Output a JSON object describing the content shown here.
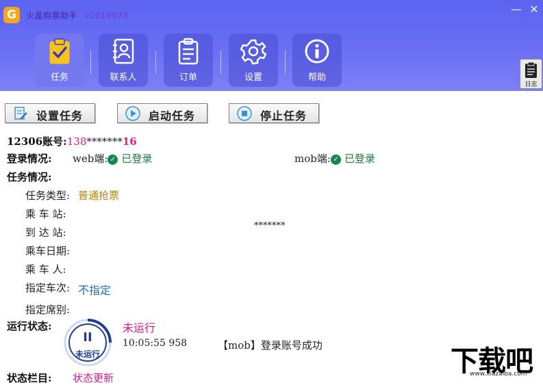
{
  "window": {
    "title": "火晶购票助手",
    "version": "v2019073",
    "logo_glyph": "G",
    "minimize_glyph": "—",
    "close_glyph": "✕"
  },
  "nav": {
    "items": [
      {
        "label": "任务",
        "icon": "clipboard-check-icon",
        "active": true
      },
      {
        "label": "联系人",
        "icon": "contacts-book-icon",
        "active": false
      },
      {
        "label": "订单",
        "icon": "order-list-icon",
        "active": false
      },
      {
        "label": "设置",
        "icon": "gear-icon",
        "active": false
      },
      {
        "label": "帮助",
        "icon": "info-icon",
        "active": false
      }
    ],
    "log_label": "日志"
  },
  "toolbar": {
    "setup_label": "设置任务",
    "start_label": "启动任务",
    "stop_label": "停止任务"
  },
  "account": {
    "label": "12306账号:",
    "prefix": "138",
    "mask": "*******",
    "suffix": "16"
  },
  "login": {
    "label": "登录情况:",
    "web_label": "web端:",
    "web_status": "已登录",
    "mob_label": "mob端:",
    "mob_status": "已登录"
  },
  "task": {
    "label": "任务情况:",
    "type_label": "任务类型:",
    "type_value": "普通抢票",
    "from_label": "乘 车 站:",
    "to_label": "到 达 站:",
    "to_value": "*******",
    "date_label": "乘车日期:",
    "passenger_label": "乘 车 人:",
    "train_label": "指定车次:",
    "train_value": "不指定",
    "seat_label": "指定席别:"
  },
  "status": {
    "label": "运行状态:",
    "state": "未运行",
    "indicator_glyph": "II",
    "indicator_text": "未运行",
    "log_time": "10:05:55 958",
    "log_message": "【mob】登录账号成功",
    "next_label_partial": "状态栏目:",
    "next_value_partial": "状态更新"
  },
  "watermark": {
    "brand": "下载吧",
    "url": "www.xiazaiba.com"
  },
  "colors": {
    "header_blue": "#5b63f0",
    "active_tab": "#7378ee",
    "account_pink": "#e0207a",
    "login_green": "#138a4a",
    "task_type_gold": "#b8860b",
    "train_blue": "#1a6fb5",
    "state_pink": "#d81b8b",
    "indicator_navy": "#1f3e8f"
  }
}
